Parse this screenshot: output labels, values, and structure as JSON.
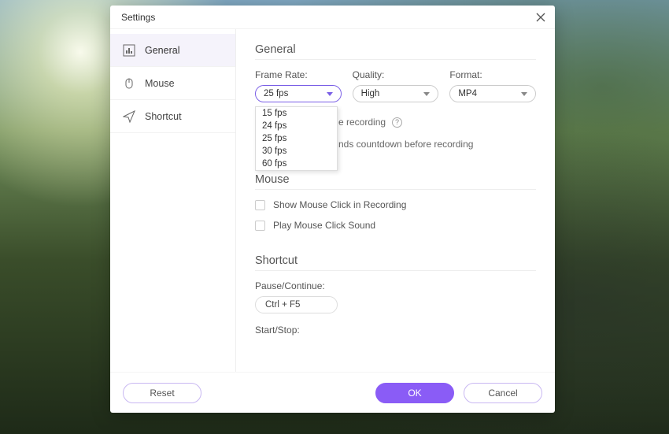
{
  "window": {
    "title": "Settings"
  },
  "sidebar": {
    "items": [
      {
        "label": "General",
        "icon": "bar-chart-icon",
        "active": true
      },
      {
        "label": "Mouse",
        "icon": "mouse-icon",
        "active": false
      },
      {
        "label": "Shortcut",
        "icon": "paper-plane-icon",
        "active": false
      }
    ]
  },
  "sections": {
    "general": {
      "title": "General",
      "frame_rate": {
        "label": "Frame Rate:",
        "selected": "25 fps",
        "options": [
          "15 fps",
          "24 fps",
          "25 fps",
          "30 fps",
          "60 fps"
        ]
      },
      "quality": {
        "label": "Quality:",
        "selected": "High"
      },
      "format": {
        "label": "Format:",
        "selected": "MP4"
      },
      "hide_text_partial": "e recording",
      "countdown_text_partial": "nds countdown before recording"
    },
    "mouse": {
      "title": "Mouse",
      "show_click_label": "Show Mouse Click in Recording",
      "play_sound_label": "Play Mouse Click Sound"
    },
    "shortcut": {
      "title": "Shortcut",
      "pause_label": "Pause/Continue:",
      "pause_value": "Ctrl + F5",
      "startstop_label": "Start/Stop:"
    }
  },
  "footer": {
    "reset": "Reset",
    "ok": "OK",
    "cancel": "Cancel"
  }
}
